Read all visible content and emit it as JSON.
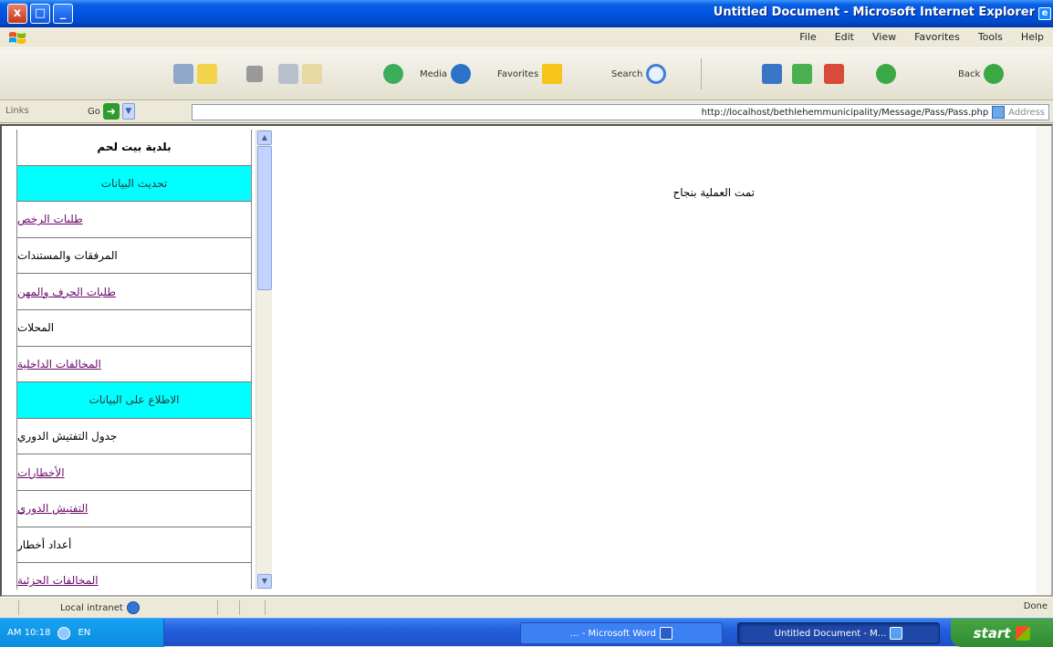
{
  "window": {
    "title": "Untitled Document - Microsoft Internet Explorer",
    "close_label": "x",
    "maximize_label": "□",
    "minimize_label": "_"
  },
  "menu": [
    "Help",
    "Tools",
    "Favorites",
    "View",
    "Edit",
    "File"
  ],
  "toolbar": {
    "back_label": "Back",
    "media_label": "Media",
    "favorites_label": "Favorites",
    "search_label": "Search"
  },
  "addressbar": {
    "links_label": "Links",
    "go_label": "Go",
    "url": "http://localhost/bethlehemmunicipality/Message/Pass/Pass.php",
    "address_label": "Address"
  },
  "nav": {
    "items": [
      {
        "label": "بلدية بيت لحم",
        "type": "header"
      },
      {
        "label": "تحديث البيانات",
        "type": "highlight"
      },
      {
        "label": "طلبات الرخص",
        "type": "link"
      },
      {
        "label": "المرفقات والمستندات",
        "type": "plain"
      },
      {
        "label": "طلبات الحرف والمهن",
        "type": "link"
      },
      {
        "label": "المحلات",
        "type": "plain"
      },
      {
        "label": "المخالفات الداخلية",
        "type": "link"
      },
      {
        "label": "الاطلاع على البيانات",
        "type": "highlight"
      },
      {
        "label": "جدول التفتيش الدوري",
        "type": "plain"
      },
      {
        "label": "الأخطارات",
        "type": "link"
      },
      {
        "label": "التفتيش الدوري",
        "type": "link"
      },
      {
        "label": "أعداد أخطار",
        "type": "plain"
      },
      {
        "label": "المخالفات الجزئية",
        "type": "link"
      }
    ]
  },
  "main": {
    "message": "تمت العملية بنجاح"
  },
  "status": {
    "zone_label": "Local intranet",
    "done_label": "Done"
  },
  "taskbar": {
    "clock": "AM 10:18",
    "lang": "EN",
    "task_word": "... - Microsoft Word",
    "task_ie": "Untitled Document - M...",
    "start_label": "start"
  }
}
